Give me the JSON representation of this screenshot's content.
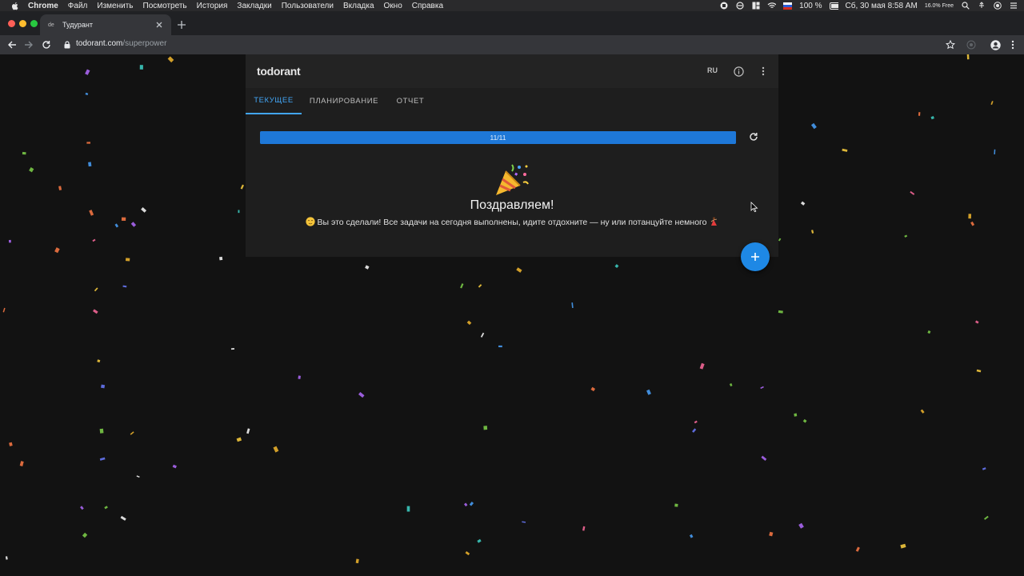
{
  "menubar": {
    "app_name": "Chrome",
    "items": [
      "Файл",
      "Изменить",
      "Посмотреть",
      "История",
      "Закладки",
      "Пользователи",
      "Вкладка",
      "Окно",
      "Справка"
    ],
    "battery": "100 %",
    "datetime": "Сб, 30 мая  8:58 AM",
    "memory": "16.0% Free"
  },
  "browser": {
    "tab_title": "Тудурант",
    "favicon_text": "de",
    "url_host": "todorant.com",
    "url_path": "/superpower"
  },
  "app": {
    "logo": "todorant",
    "language": "RU",
    "tabs": [
      {
        "label": "ТЕКУЩЕЕ",
        "active": true
      },
      {
        "label": "ПЛАНИРОВАНИЕ",
        "active": false
      },
      {
        "label": "ОТЧЕТ",
        "active": false
      }
    ],
    "progress": {
      "label": "11/11",
      "completed": 11,
      "total": 11
    },
    "congrats_title": "Поздравляем!",
    "congrats_text": "Вы это сделали! Все задачи на сегодня выполнены, идите отдохните — ну или потанцуйте немного",
    "accent_color": "#1e88e5",
    "fab_icon": "plus-icon"
  }
}
